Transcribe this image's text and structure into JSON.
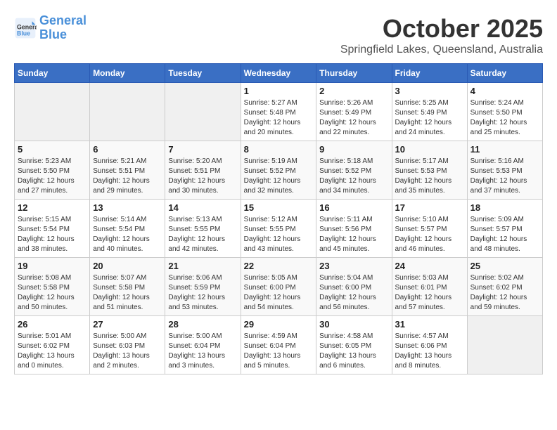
{
  "logo": {
    "line1": "General",
    "line2": "Blue"
  },
  "title": "October 2025",
  "subtitle": "Springfield Lakes, Queensland, Australia",
  "headers": [
    "Sunday",
    "Monday",
    "Tuesday",
    "Wednesday",
    "Thursday",
    "Friday",
    "Saturday"
  ],
  "weeks": [
    [
      {
        "day": "",
        "info": ""
      },
      {
        "day": "",
        "info": ""
      },
      {
        "day": "",
        "info": ""
      },
      {
        "day": "1",
        "info": "Sunrise: 5:27 AM\nSunset: 5:48 PM\nDaylight: 12 hours\nand 20 minutes."
      },
      {
        "day": "2",
        "info": "Sunrise: 5:26 AM\nSunset: 5:49 PM\nDaylight: 12 hours\nand 22 minutes."
      },
      {
        "day": "3",
        "info": "Sunrise: 5:25 AM\nSunset: 5:49 PM\nDaylight: 12 hours\nand 24 minutes."
      },
      {
        "day": "4",
        "info": "Sunrise: 5:24 AM\nSunset: 5:50 PM\nDaylight: 12 hours\nand 25 minutes."
      }
    ],
    [
      {
        "day": "5",
        "info": "Sunrise: 5:23 AM\nSunset: 5:50 PM\nDaylight: 12 hours\nand 27 minutes."
      },
      {
        "day": "6",
        "info": "Sunrise: 5:21 AM\nSunset: 5:51 PM\nDaylight: 12 hours\nand 29 minutes."
      },
      {
        "day": "7",
        "info": "Sunrise: 5:20 AM\nSunset: 5:51 PM\nDaylight: 12 hours\nand 30 minutes."
      },
      {
        "day": "8",
        "info": "Sunrise: 5:19 AM\nSunset: 5:52 PM\nDaylight: 12 hours\nand 32 minutes."
      },
      {
        "day": "9",
        "info": "Sunrise: 5:18 AM\nSunset: 5:52 PM\nDaylight: 12 hours\nand 34 minutes."
      },
      {
        "day": "10",
        "info": "Sunrise: 5:17 AM\nSunset: 5:53 PM\nDaylight: 12 hours\nand 35 minutes."
      },
      {
        "day": "11",
        "info": "Sunrise: 5:16 AM\nSunset: 5:53 PM\nDaylight: 12 hours\nand 37 minutes."
      }
    ],
    [
      {
        "day": "12",
        "info": "Sunrise: 5:15 AM\nSunset: 5:54 PM\nDaylight: 12 hours\nand 38 minutes."
      },
      {
        "day": "13",
        "info": "Sunrise: 5:14 AM\nSunset: 5:54 PM\nDaylight: 12 hours\nand 40 minutes."
      },
      {
        "day": "14",
        "info": "Sunrise: 5:13 AM\nSunset: 5:55 PM\nDaylight: 12 hours\nand 42 minutes."
      },
      {
        "day": "15",
        "info": "Sunrise: 5:12 AM\nSunset: 5:55 PM\nDaylight: 12 hours\nand 43 minutes."
      },
      {
        "day": "16",
        "info": "Sunrise: 5:11 AM\nSunset: 5:56 PM\nDaylight: 12 hours\nand 45 minutes."
      },
      {
        "day": "17",
        "info": "Sunrise: 5:10 AM\nSunset: 5:57 PM\nDaylight: 12 hours\nand 46 minutes."
      },
      {
        "day": "18",
        "info": "Sunrise: 5:09 AM\nSunset: 5:57 PM\nDaylight: 12 hours\nand 48 minutes."
      }
    ],
    [
      {
        "day": "19",
        "info": "Sunrise: 5:08 AM\nSunset: 5:58 PM\nDaylight: 12 hours\nand 50 minutes."
      },
      {
        "day": "20",
        "info": "Sunrise: 5:07 AM\nSunset: 5:58 PM\nDaylight: 12 hours\nand 51 minutes."
      },
      {
        "day": "21",
        "info": "Sunrise: 5:06 AM\nSunset: 5:59 PM\nDaylight: 12 hours\nand 53 minutes."
      },
      {
        "day": "22",
        "info": "Sunrise: 5:05 AM\nSunset: 6:00 PM\nDaylight: 12 hours\nand 54 minutes."
      },
      {
        "day": "23",
        "info": "Sunrise: 5:04 AM\nSunset: 6:00 PM\nDaylight: 12 hours\nand 56 minutes."
      },
      {
        "day": "24",
        "info": "Sunrise: 5:03 AM\nSunset: 6:01 PM\nDaylight: 12 hours\nand 57 minutes."
      },
      {
        "day": "25",
        "info": "Sunrise: 5:02 AM\nSunset: 6:02 PM\nDaylight: 12 hours\nand 59 minutes."
      }
    ],
    [
      {
        "day": "26",
        "info": "Sunrise: 5:01 AM\nSunset: 6:02 PM\nDaylight: 13 hours\nand 0 minutes."
      },
      {
        "day": "27",
        "info": "Sunrise: 5:00 AM\nSunset: 6:03 PM\nDaylight: 13 hours\nand 2 minutes."
      },
      {
        "day": "28",
        "info": "Sunrise: 5:00 AM\nSunset: 6:04 PM\nDaylight: 13 hours\nand 3 minutes."
      },
      {
        "day": "29",
        "info": "Sunrise: 4:59 AM\nSunset: 6:04 PM\nDaylight: 13 hours\nand 5 minutes."
      },
      {
        "day": "30",
        "info": "Sunrise: 4:58 AM\nSunset: 6:05 PM\nDaylight: 13 hours\nand 6 minutes."
      },
      {
        "day": "31",
        "info": "Sunrise: 4:57 AM\nSunset: 6:06 PM\nDaylight: 13 hours\nand 8 minutes."
      },
      {
        "day": "",
        "info": ""
      }
    ]
  ]
}
